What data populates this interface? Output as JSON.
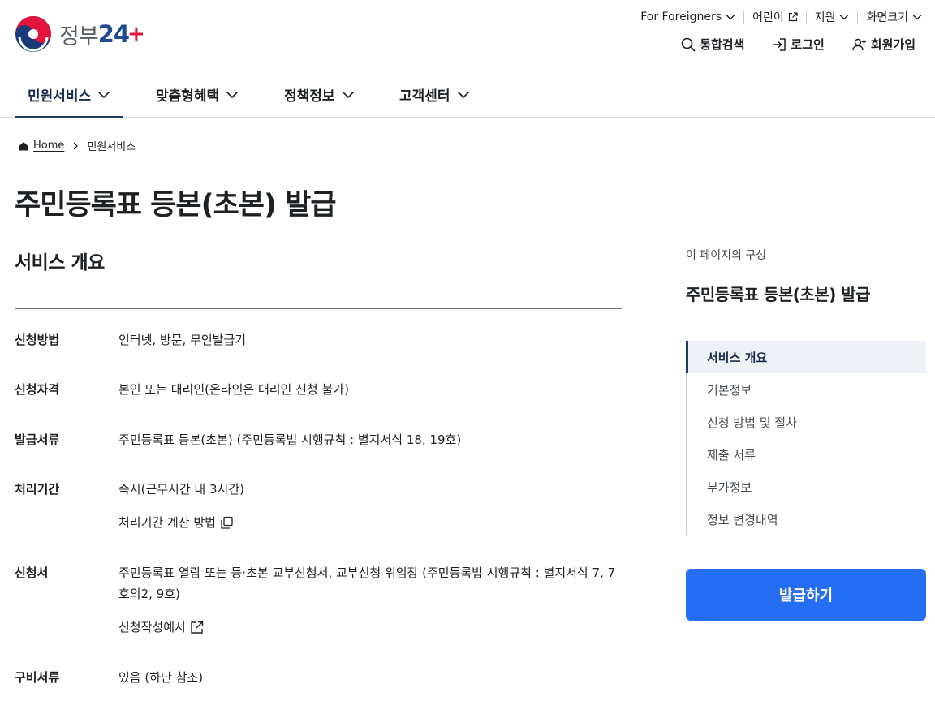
{
  "brand": {
    "text": "정부",
    "num": "24",
    "plus": "+"
  },
  "util_menu": [
    {
      "label": "For Foreigners",
      "icon": "chevron-down-icon"
    },
    {
      "label": "어린이",
      "icon": "external-link-icon"
    },
    {
      "label": "지원",
      "icon": "chevron-down-icon"
    },
    {
      "label": "화면크기",
      "icon": "chevron-down-icon"
    }
  ],
  "account": {
    "search": "통합검색",
    "login": "로그인",
    "signup": "회원가입"
  },
  "gnb": [
    {
      "label": "민원서비스",
      "active": true
    },
    {
      "label": "맞춤형혜택"
    },
    {
      "label": "정책정보"
    },
    {
      "label": "고객센터"
    }
  ],
  "breadcrumb": {
    "home": "Home",
    "current": "민원서비스"
  },
  "page_title": "주민등록표 등본(초본) 발급",
  "section": {
    "title": "서비스 개요",
    "rows": [
      {
        "label": "신청방법",
        "value": "인터넷, 방문, 무인발급기"
      },
      {
        "label": "신청자격",
        "value": "본인 또는 대리인(온라인은 대리인 신청 불가)"
      },
      {
        "label": "발급서류",
        "value": "주민등록표 등본(초본) (주민등록법 시행규칙 : 별지서식 18, 19호)"
      },
      {
        "label": "처리기간",
        "value": "즉시(근무시간 내 3시간)",
        "link": "처리기간 계산 방법"
      },
      {
        "label": "신청서",
        "value": "주민등록표 열람 또는 등·초본 교부신청서, 교부신청 위임장 (주민등록법 시행규칙 : 별지서식 7, 7호의2, 9호)",
        "link": "신청작성예시"
      },
      {
        "label": "구비서류",
        "value": "있음 (하단 참조)"
      }
    ]
  },
  "sidebar": {
    "caption": "이 페이지의 구성",
    "title": "주민등록표 등본(초본) 발급",
    "toc": [
      "서비스 개요",
      "기본정보",
      "신청 방법 및 절차",
      "제출 서류",
      "부가정보",
      "정보 변경내역"
    ],
    "button": "발급하기"
  },
  "colors": {
    "primary": "#256ef4",
    "navy": "#1c3b6b",
    "red": "#e3143c"
  }
}
